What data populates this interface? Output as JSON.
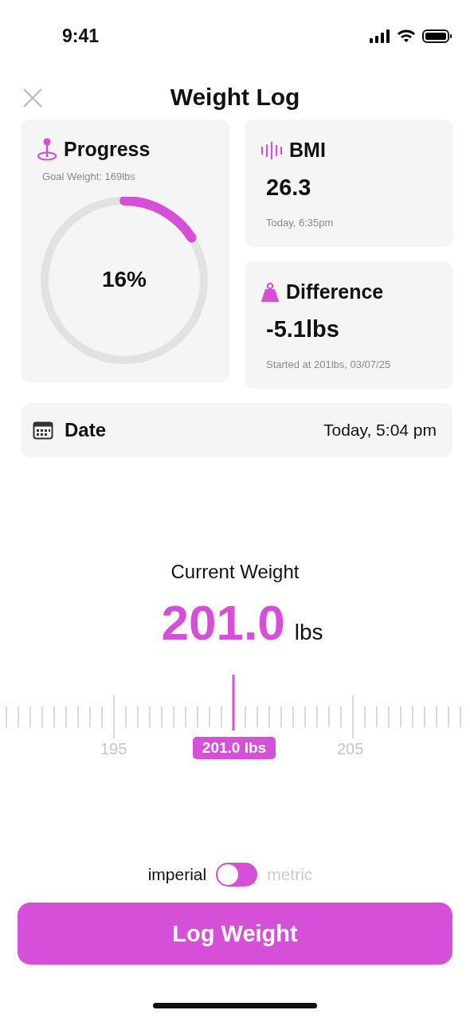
{
  "status_bar": {
    "time": "9:41"
  },
  "header": {
    "title": "Weight Log"
  },
  "progress": {
    "title": "Progress",
    "subtitle": "Goal Weight: 169lbs",
    "level": 0.16,
    "percent": "16%"
  },
  "bmi": {
    "title": "BMI",
    "value": "26.3",
    "note": "Today, 6:35pm"
  },
  "difference": {
    "title": "Difference",
    "value": "-5.1lbs",
    "note": "Started at 201lbs, 03/07/25"
  },
  "date": {
    "label": "Date",
    "value": "Today, 5:04 pm"
  },
  "current_weight": {
    "label": "Current Weight",
    "value": "201.0",
    "unit": "lbs"
  },
  "ruler": {
    "labels": [
      "195",
      "205"
    ],
    "selected_label": "201.0 lbs"
  },
  "units": [
    {
      "label": "imperial",
      "selected": true
    },
    {
      "label": "metric",
      "selected": false
    }
  ],
  "button": {
    "label": "Log Weight"
  }
}
